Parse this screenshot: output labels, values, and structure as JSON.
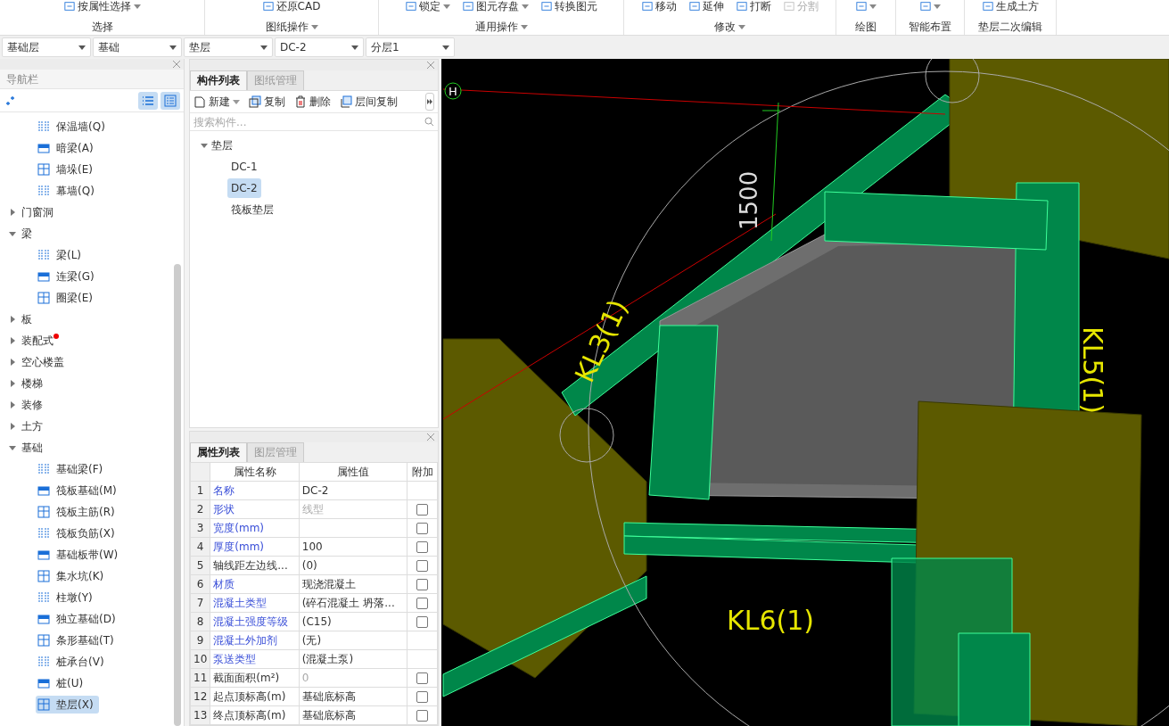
{
  "ribbon": {
    "groups": [
      {
        "label": "选择",
        "caret": false,
        "buttons": [
          {
            "label": "按属性选择",
            "dropdown": true,
            "disabled": false
          }
        ]
      },
      {
        "label": "图纸操作",
        "caret": true,
        "buttons": [
          {
            "label": "还原CAD",
            "dropdown": false,
            "disabled": false
          }
        ]
      },
      {
        "label": "通用操作",
        "caret": true,
        "buttons": [
          {
            "label": "锁定",
            "dropdown": true,
            "disabled": false
          },
          {
            "label": "图元存盘",
            "dropdown": true,
            "disabled": false
          },
          {
            "label": "转换图元",
            "dropdown": false,
            "disabled": false
          }
        ]
      },
      {
        "label": "修改",
        "caret": true,
        "buttons": [
          {
            "label": "移动",
            "dropdown": false,
            "disabled": false
          },
          {
            "label": "延伸",
            "dropdown": false,
            "disabled": false
          },
          {
            "label": "打断",
            "dropdown": false,
            "disabled": false
          },
          {
            "label": "分割",
            "dropdown": false,
            "disabled": true
          }
        ]
      },
      {
        "label": "绘图",
        "caret": false,
        "buttons": [
          {
            "dropdown": true,
            "disabled": false
          }
        ]
      },
      {
        "label": "智能布置",
        "caret": false,
        "buttons": [
          {
            "dropdown": true,
            "disabled": false
          }
        ]
      },
      {
        "label": "垫层二次编辑",
        "caret": false,
        "buttons": [
          {
            "label": "生成土方",
            "dropdown": false,
            "disabled": false
          }
        ]
      }
    ]
  },
  "selectors": [
    {
      "value": "基础层"
    },
    {
      "value": "基础"
    },
    {
      "value": "垫层"
    },
    {
      "value": "DC-2"
    },
    {
      "value": "分层1"
    }
  ],
  "nav": {
    "title": "导航栏",
    "items": [
      {
        "expanded": true,
        "children": [
          {
            "label": "保温墙(Q)",
            "selected": false
          },
          {
            "label": "暗梁(A)",
            "selected": false
          },
          {
            "label": "墙垛(E)",
            "selected": false
          },
          {
            "label": "幕墙(Q)",
            "selected": false
          }
        ]
      },
      {
        "label": "门窗洞",
        "expanded": false,
        "new": false
      },
      {
        "label": "梁",
        "expanded": true,
        "new": false,
        "children": [
          {
            "label": "梁(L)",
            "selected": false
          },
          {
            "label": "连梁(G)",
            "selected": false
          },
          {
            "label": "圈梁(E)",
            "selected": false
          }
        ]
      },
      {
        "label": "板",
        "expanded": false,
        "new": false
      },
      {
        "label": "装配式",
        "expanded": false,
        "new": true
      },
      {
        "label": "空心楼盖",
        "expanded": false,
        "new": false
      },
      {
        "label": "楼梯",
        "expanded": false,
        "new": false
      },
      {
        "label": "装修",
        "expanded": false,
        "new": false
      },
      {
        "label": "土方",
        "expanded": false,
        "new": false
      },
      {
        "label": "基础",
        "expanded": true,
        "new": false,
        "children": [
          {
            "label": "基础梁(F)",
            "selected": false
          },
          {
            "label": "筏板基础(M)",
            "selected": false
          },
          {
            "label": "筏板主筋(R)",
            "selected": false
          },
          {
            "label": "筏板负筋(X)",
            "selected": false
          },
          {
            "label": "基础板带(W)",
            "selected": false
          },
          {
            "label": "集水坑(K)",
            "selected": false
          },
          {
            "label": "柱墩(Y)",
            "selected": false
          },
          {
            "label": "独立基础(D)",
            "selected": false
          },
          {
            "label": "条形基础(T)",
            "selected": false
          },
          {
            "label": "桩承台(V)",
            "selected": false
          },
          {
            "label": "桩(U)",
            "selected": false
          },
          {
            "label": "垫层(X)",
            "selected": true
          }
        ]
      }
    ]
  },
  "components": {
    "tabs": [
      {
        "label": "构件列表",
        "selected": true
      },
      {
        "label": "图纸管理",
        "selected": false
      }
    ],
    "toolbar": [
      {
        "label": "新建",
        "dropdown": true
      },
      {
        "label": "复制",
        "dropdown": false
      },
      {
        "label": "删除",
        "dropdown": false
      },
      {
        "label": "层间复制",
        "dropdown": false
      }
    ],
    "search": {
      "placeholder": "搜索构件..."
    },
    "tree": [
      {
        "label": "垫层",
        "expanded": true,
        "children": [
          {
            "label": "DC-1",
            "selected": false
          },
          {
            "label": "DC-2",
            "selected": true
          },
          {
            "label": "筏板垫层",
            "selected": false
          }
        ]
      }
    ]
  },
  "properties": {
    "tabs": [
      {
        "label": "属性列表",
        "selected": true
      },
      {
        "label": "图层管理",
        "selected": false
      }
    ],
    "columns": [
      "属性名称",
      "属性值",
      "附加"
    ],
    "rows": [
      {
        "num": "1",
        "name": "名称",
        "value": "DC-2",
        "public": true,
        "value_dim": false
      },
      {
        "num": "2",
        "name": "形状",
        "value": "线型",
        "public": true,
        "value_dim": true,
        "checked": false
      },
      {
        "num": "3",
        "name": "宽度(mm)",
        "public": true,
        "checked": false
      },
      {
        "num": "4",
        "name": "厚度(mm)",
        "value": "100",
        "public": true,
        "value_dim": false,
        "checked": false
      },
      {
        "num": "5",
        "name": "轴线距左边线...",
        "value": "(0)",
        "public": false,
        "value_dim": false,
        "checked": false
      },
      {
        "num": "6",
        "name": "材质",
        "value": "现浇混凝土",
        "public": true,
        "value_dim": false,
        "checked": false
      },
      {
        "num": "7",
        "name": "混凝土类型",
        "value": "(碎石混凝土 坍落...",
        "public": true,
        "value_dim": false,
        "checked": false
      },
      {
        "num": "8",
        "name": "混凝土强度等级",
        "value": "(C15)",
        "public": true,
        "value_dim": false,
        "checked": false
      },
      {
        "num": "9",
        "name": "混凝土外加剂",
        "value": "(无)",
        "public": true,
        "value_dim": false
      },
      {
        "num": "10",
        "name": "泵送类型",
        "value": "(混凝土泵)",
        "public": true,
        "value_dim": false
      },
      {
        "num": "11",
        "name": "截面面积(m²)",
        "value": "0",
        "public": false,
        "value_dim": true,
        "checked": false
      },
      {
        "num": "12",
        "name": "起点顶标高(m)",
        "value": "基础底标高",
        "public": false,
        "value_dim": false,
        "checked": false
      },
      {
        "num": "13",
        "name": "终点顶标高(m)",
        "value": "基础底标高",
        "public": false,
        "value_dim": false,
        "checked": false
      }
    ]
  },
  "viewport": {
    "axis_marker": "H",
    "dimension": "1500",
    "beam_labels": [
      "KL3(1)",
      "KL5(1)",
      "KL6(1)"
    ]
  }
}
